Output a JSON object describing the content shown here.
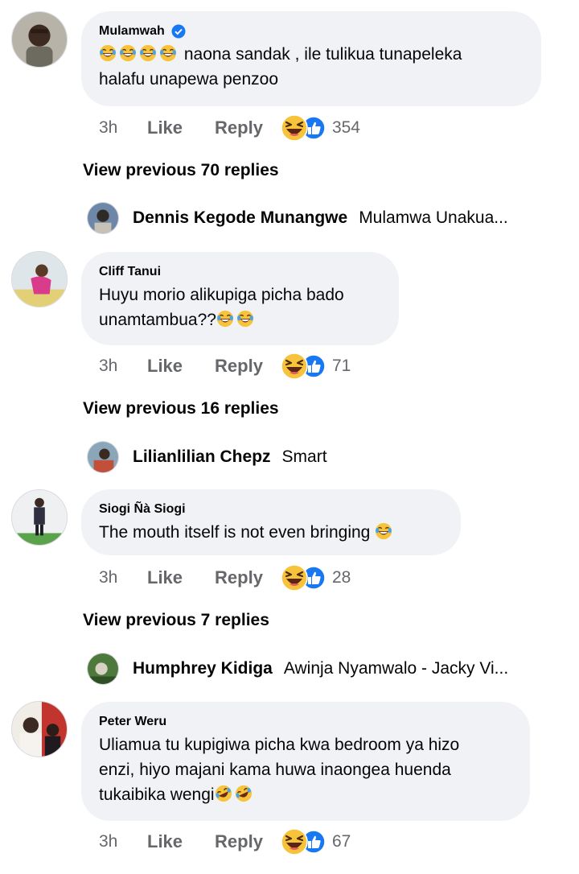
{
  "comments": [
    {
      "author": "Mulamwah",
      "verified": true,
      "text_line1": "naona sandak , ile tulikua tunapeleka",
      "text_line2": "halafu unapewa penzoo",
      "time": "3h",
      "like": "Like",
      "reply": "Reply",
      "reactions": "354",
      "view_previous": "View previous 70 replies",
      "reply_preview": {
        "name": "Dennis Kegode Munangwe",
        "text": "Mulamwa Unakua..."
      }
    },
    {
      "author": "Cliff Tanui",
      "text_line1": "Huyu morio alikupiga picha bado",
      "text_line2": "unamtambua??",
      "time": "3h",
      "like": "Like",
      "reply": "Reply",
      "reactions": "71",
      "view_previous": "View previous 16 replies",
      "reply_preview": {
        "name": "Lilianlilian Chepz",
        "text": "Smart"
      }
    },
    {
      "author": "Siogi Ñà Siogi",
      "text_line1": "The mouth itself is not even bringing",
      "time": "3h",
      "like": "Like",
      "reply": "Reply",
      "reactions": "28",
      "view_previous": "View previous 7 replies",
      "reply_preview": {
        "name": "Humphrey Kidiga",
        "text": "Awinja Nyamwalo - Jacky Vi..."
      }
    },
    {
      "author": "Peter Weru",
      "text_line1": "Uliamua tu kupigiwa picha kwa bedroom ya hizo",
      "text_line2": "enzi, hiyo majani kama huwa inaongea huenda",
      "text_line3": "tukaibika wengi",
      "time": "3h",
      "like": "Like",
      "reply": "Reply",
      "reactions": "67"
    }
  ],
  "colors": {
    "bubble": "#f0f2f5",
    "muted": "#65676b",
    "like_blue": "#1877f2",
    "haha_yellow": "#f7c33b"
  },
  "icons": [
    "verified-badge-icon",
    "joy-emoji-icon",
    "rofl-emoji-icon",
    "haha-reaction-icon",
    "like-reaction-icon"
  ]
}
